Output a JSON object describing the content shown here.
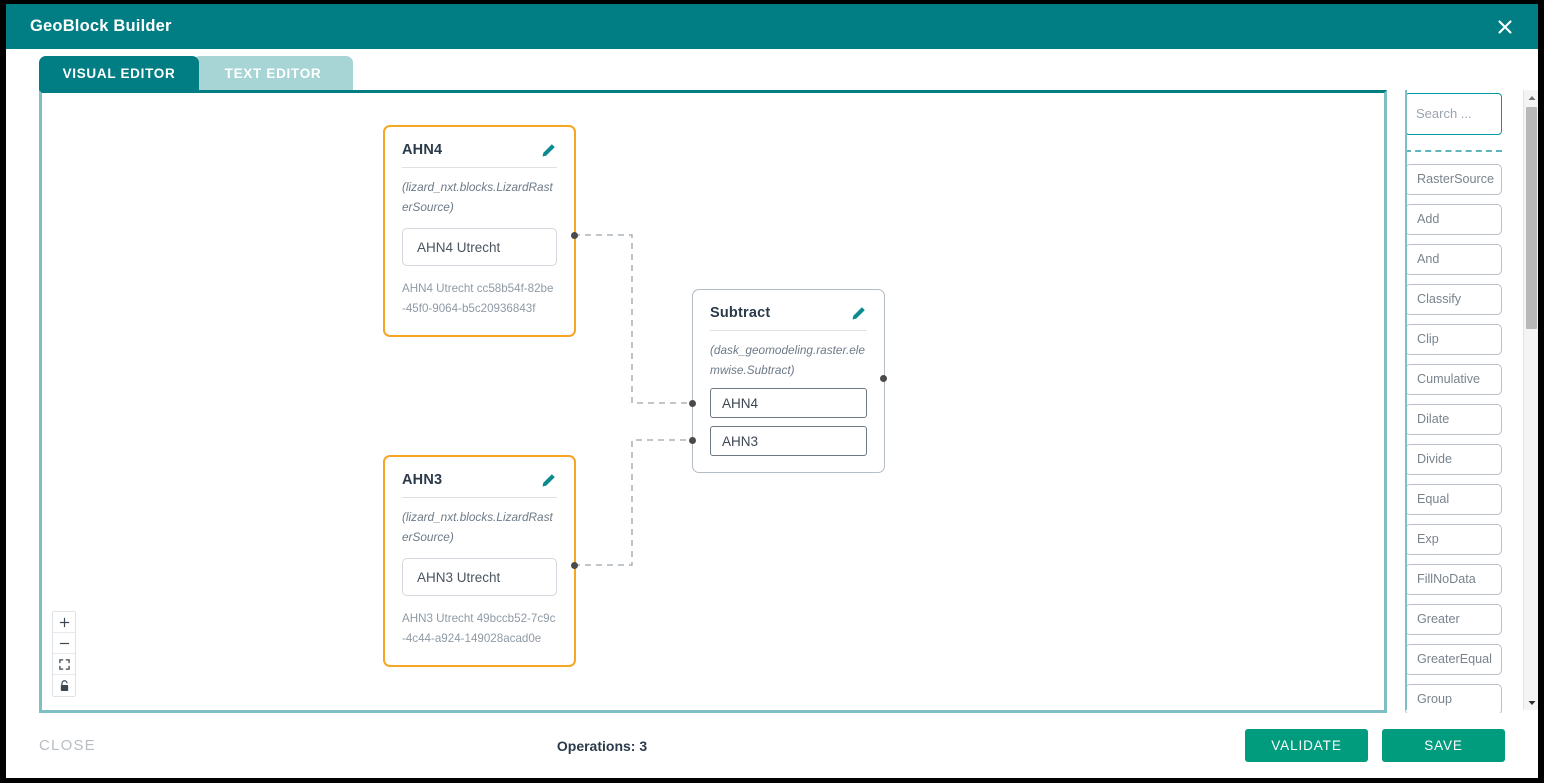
{
  "window": {
    "title": "GeoBlock Builder",
    "close_icon": "close-icon"
  },
  "tabs": [
    {
      "label": "VISUAL EDITOR",
      "active": true
    },
    {
      "label": "TEXT EDITOR",
      "active": false
    }
  ],
  "canvas": {
    "nodes": [
      {
        "id": "ahn4",
        "title": "AHN4",
        "class_path": "(lizard_nxt.blocks.LizardRasterSource)",
        "input_value": "AHN4 Utrecht",
        "meta": "AHN4 Utrecht cc58b54f-82be-45f0-9064-b5c20936843f",
        "type": "source"
      },
      {
        "id": "subtract",
        "title": "Subtract",
        "class_path": "(dask_geomodeling.raster.elemwise.Subtract)",
        "args": [
          "AHN4",
          "AHN3"
        ],
        "type": "operation"
      },
      {
        "id": "ahn3",
        "title": "AHN3",
        "class_path": "(lizard_nxt.blocks.LizardRasterSource)",
        "input_value": "AHN3 Utrecht",
        "meta": "AHN3 Utrecht 49bccb52-7c9c-4c44-a924-149028acad0e",
        "type": "source"
      }
    ],
    "edit_icon": "pencil-icon",
    "zoom_controls": [
      {
        "label": "+",
        "name": "zoom-in-icon"
      },
      {
        "label": "−",
        "name": "zoom-out-icon"
      },
      {
        "label": "",
        "name": "fit-view-icon"
      },
      {
        "label": "",
        "name": "lock-icon"
      }
    ]
  },
  "sidebar": {
    "search_placeholder": "Search ...",
    "search_value": "",
    "blocks": [
      "RasterSource",
      "Add",
      "And",
      "Classify",
      "Clip",
      "Cumulative",
      "Dilate",
      "Divide",
      "Equal",
      "Exp",
      "FillNoData",
      "Greater",
      "GreaterEqual",
      "Group"
    ],
    "scroll_up_icon": "chevron-up-icon",
    "scroll_down_icon": "chevron-down-icon"
  },
  "footer": {
    "close_label": "CLOSE",
    "operations_label": "Operations: 3",
    "validate_label": "VALIDATE",
    "save_label": "SAVE"
  },
  "colors": {
    "brand_teal": "#017e84",
    "tab_inactive": "#a7d4d4",
    "accent_green": "#019c7e",
    "source_border": "#f5a623",
    "edge_gray": "#9aa3ab"
  }
}
